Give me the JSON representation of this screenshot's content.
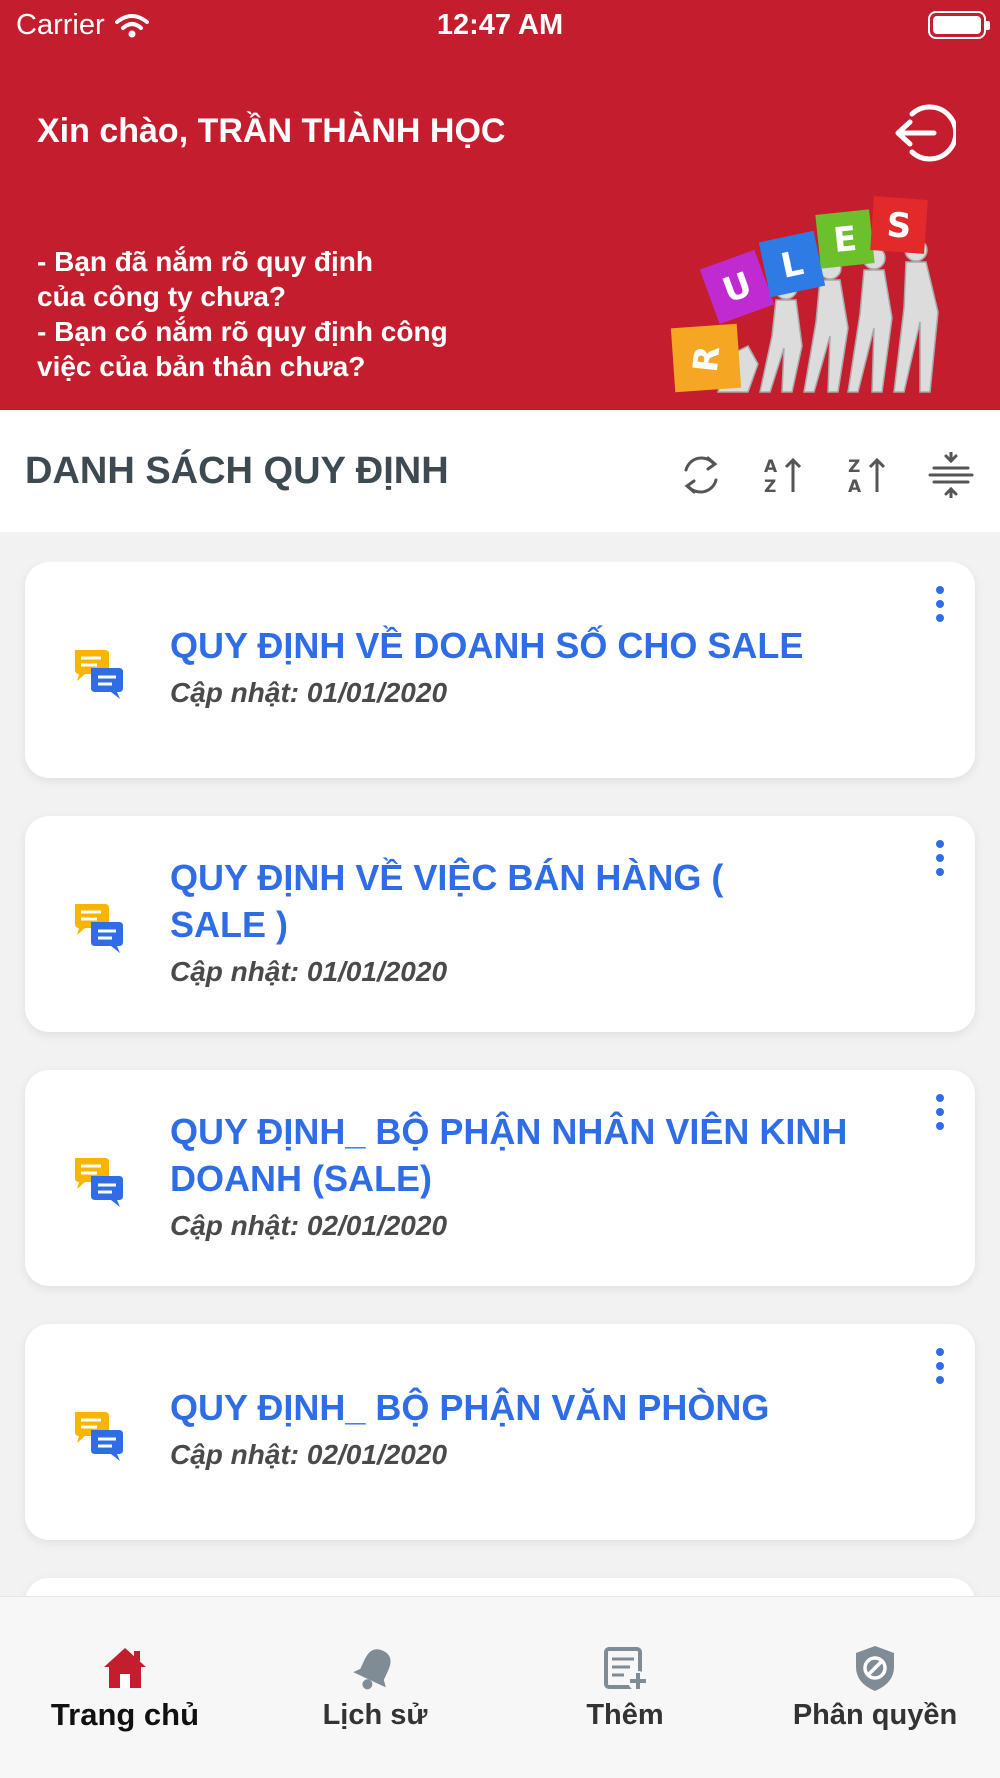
{
  "status_bar": {
    "carrier": "Carrier",
    "time": "12:47 AM"
  },
  "header": {
    "greeting": "Xin chào, TRẦN THÀNH HỌC",
    "question_lines": [
      "- Bạn đã nắm rõ quy định",
      "của công ty chưa?",
      "- Bạn có nắm rõ quy định công",
      "việc của bản thân chưa?"
    ],
    "art_letters": [
      "R",
      "U",
      "L",
      "E",
      "S"
    ]
  },
  "toolbar": {
    "title": "DANH SÁCH QUY ĐỊNH"
  },
  "rules": [
    {
      "title": "QUY ĐỊNH VỀ DOANH SỐ CHO SALE",
      "updated": "Cập nhật: 01/01/2020"
    },
    {
      "title": "QUY ĐỊNH VỀ VIỆC BÁN HÀNG ( SALE )",
      "updated": "Cập nhật: 01/01/2020"
    },
    {
      "title": "QUY ĐỊNH_ BỘ PHẬN NHÂN VIÊN KINH DOANH (SALE)",
      "updated": "Cập nhật: 02/01/2020"
    },
    {
      "title": "QUY ĐỊNH_ BỘ PHẬN VĂN PHÒNG",
      "updated": "Cập nhật: 02/01/2020"
    }
  ],
  "tabs": [
    {
      "label": "Trang chủ",
      "icon": "home-icon",
      "active": true
    },
    {
      "label": "Lịch sử",
      "icon": "bell-icon",
      "active": false
    },
    {
      "label": "Thêm",
      "icon": "add-document-icon",
      "active": false
    },
    {
      "label": "Phân quyền",
      "icon": "shield-icon",
      "active": false
    }
  ],
  "colors": {
    "header": "#c41e2e",
    "accent": "#2f6de6",
    "tab_active": "#c41e2e",
    "tab_inactive": "#7f8c96"
  }
}
